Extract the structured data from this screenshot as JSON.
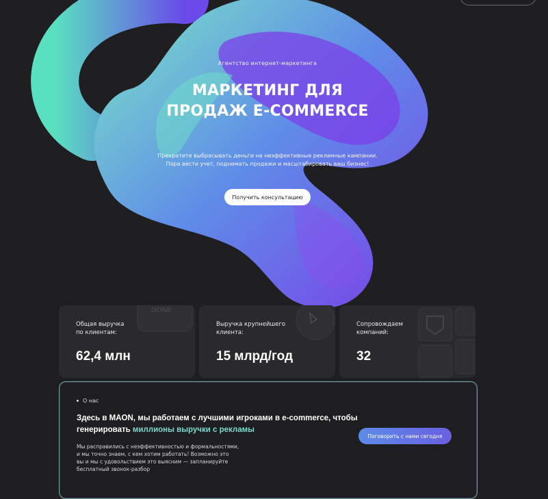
{
  "hero": {
    "kicker": "Агентство интернет-маркетинга",
    "title_lines": [
      "МАРКЕТИНГ ДЛЯ",
      "ПРОДАЖ E-COMMERCE"
    ],
    "subtitle_lines": [
      "Прекратите выбрасывать деньги на неэффективные рекламные кампании.",
      "Пора вести учет, поднимать продажи и масштабировать ваш бизнес!"
    ],
    "cta_label": "Получить консультацию"
  },
  "stats": [
    {
      "label_lines": [
        "Общая выручка",
        "по клиентам:"
      ],
      "value": "62,4 млн",
      "ghost_text": "DONE"
    },
    {
      "label_lines": [
        "Выручка крупнейшего",
        "клиента:"
      ],
      "value": "15 млрд/год"
    },
    {
      "label_lines": [
        "Сопровождаем",
        "компаний:"
      ],
      "value": "32"
    }
  ],
  "about": {
    "kicker": "О нас",
    "heading_prefix": "Здесь в MAON, мы работаем с лучшими игроками в e-commerce, чтобы генерировать",
    "heading_highlight": "миллионы выручки с рекламы",
    "button_label": "Поговорить с нами сегодня",
    "body_lines": [
      "Мы расправились с неэффективностью и формальностями,",
      "и мы точно знаем, с кем хотим работать! Возможно это",
      "вы и мы с удовольствием это выясним — запланируйте",
      "бесплатный звонок-разбор"
    ]
  },
  "colors": {
    "background": "#1f1f21",
    "card": "#2a2a2d",
    "accent_teal": "#7ad9cf",
    "accent_violet": "#6a5fe0",
    "blob_teal": "#66e0c8",
    "blob_purple": "#7b3fe8"
  }
}
